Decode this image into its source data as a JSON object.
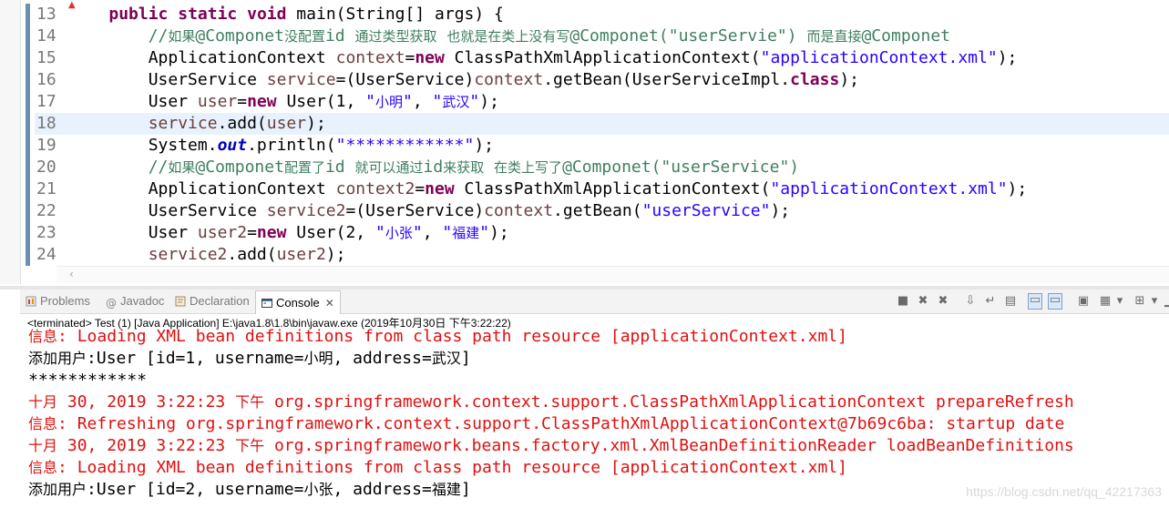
{
  "editor": {
    "lines": [
      {
        "num": "13",
        "segs": [
          [
            "pl",
            "    "
          ],
          [
            "kw",
            "public"
          ],
          [
            "pl",
            " "
          ],
          [
            "kw",
            "static"
          ],
          [
            "pl",
            " "
          ],
          [
            "kw",
            "void"
          ],
          [
            "pl",
            " main(String[] args) {"
          ]
        ]
      },
      {
        "num": "14",
        "segs": [
          [
            "pl",
            "        "
          ],
          [
            "cm",
            "//如果@Componet没配置id 通过类型获取 也就是在类上没有写@Componet(\"userServie\") 而是直接@Componet"
          ]
        ]
      },
      {
        "num": "15",
        "segs": [
          [
            "pl",
            "        ApplicationContext "
          ],
          [
            "var",
            "context"
          ],
          [
            "pl",
            "="
          ],
          [
            "kw",
            "new"
          ],
          [
            "pl",
            " ClassPathXmlApplicationContext("
          ],
          [
            "str",
            "\"applicationContext.xml\""
          ],
          [
            "pl",
            ");"
          ]
        ]
      },
      {
        "num": "16",
        "segs": [
          [
            "pl",
            "        UserService "
          ],
          [
            "var",
            "service"
          ],
          [
            "pl",
            "=(UserService)"
          ],
          [
            "var",
            "context"
          ],
          [
            "pl",
            ".getBean(UserServiceImpl."
          ],
          [
            "kw",
            "class"
          ],
          [
            "pl",
            ");"
          ]
        ]
      },
      {
        "num": "17",
        "segs": [
          [
            "pl",
            "        User "
          ],
          [
            "var",
            "user"
          ],
          [
            "pl",
            "="
          ],
          [
            "kw",
            "new"
          ],
          [
            "pl",
            " User(1, "
          ],
          [
            "str",
            "\"小明\""
          ],
          [
            "pl",
            ", "
          ],
          [
            "str",
            "\"武汉\""
          ],
          [
            "pl",
            ");"
          ]
        ]
      },
      {
        "num": "18",
        "segs": [
          [
            "pl",
            "        "
          ],
          [
            "var",
            "service"
          ],
          [
            "pl",
            ".add("
          ],
          [
            "var",
            "user"
          ],
          [
            "pl",
            ");"
          ]
        ]
      },
      {
        "num": "19",
        "segs": [
          [
            "pl",
            "        System."
          ],
          [
            "sf",
            "out"
          ],
          [
            "pl",
            ".println("
          ],
          [
            "str",
            "\"************\""
          ],
          [
            "pl",
            ");"
          ]
        ]
      },
      {
        "num": "20",
        "segs": [
          [
            "pl",
            "        "
          ],
          [
            "cm",
            "//如果@Componet配置了id 就可以通过id来获取 在类上写了@Componet(\"userService\")"
          ]
        ]
      },
      {
        "num": "21",
        "segs": [
          [
            "pl",
            "        ApplicationContext "
          ],
          [
            "var",
            "context2"
          ],
          [
            "pl",
            "="
          ],
          [
            "kw",
            "new"
          ],
          [
            "pl",
            " ClassPathXmlApplicationContext("
          ],
          [
            "str",
            "\"applicationContext.xml\""
          ],
          [
            "pl",
            ");"
          ]
        ]
      },
      {
        "num": "22",
        "segs": [
          [
            "pl",
            "        UserService "
          ],
          [
            "var",
            "service2"
          ],
          [
            "pl",
            "=(UserService)"
          ],
          [
            "var",
            "context"
          ],
          [
            "pl",
            ".getBean("
          ],
          [
            "str",
            "\"userService\""
          ],
          [
            "pl",
            ");"
          ]
        ]
      },
      {
        "num": "23",
        "segs": [
          [
            "pl",
            "        User "
          ],
          [
            "var",
            "user2"
          ],
          [
            "pl",
            "="
          ],
          [
            "kw",
            "new"
          ],
          [
            "pl",
            " User(2, "
          ],
          [
            "str",
            "\"小张\""
          ],
          [
            "pl",
            ", "
          ],
          [
            "str",
            "\"福建\""
          ],
          [
            "pl",
            ");"
          ]
        ]
      },
      {
        "num": "24",
        "segs": [
          [
            "pl",
            "        "
          ],
          [
            "var",
            "service2"
          ],
          [
            "pl",
            ".add("
          ],
          [
            "var",
            "user2"
          ],
          [
            "pl",
            ");"
          ]
        ]
      }
    ],
    "current_line": "18",
    "scroll_left_glyph": "‹"
  },
  "tabs": {
    "problems": "Problems",
    "javadoc": "Javadoc",
    "declaration": "Declaration",
    "console": "Console",
    "close_glyph": "✕"
  },
  "console": {
    "header": "<terminated> Test (1) [Java Application] E:\\java1.8\\1.8\\bin\\javaw.exe (2019年10月30日 下午3:22:22)",
    "lines": [
      {
        "kind": "err",
        "text": "信息: Loading XML bean definitions from class path resource [applicationContext.xml]"
      },
      {
        "kind": "out",
        "text": "添加用户:User [id=1, username=小明, address=武汉]"
      },
      {
        "kind": "out",
        "text": "************"
      },
      {
        "kind": "err",
        "text": "十月 30, 2019 3:22:23 下午 org.springframework.context.support.ClassPathXmlApplicationContext prepareRefresh"
      },
      {
        "kind": "err",
        "text": "信息: Refreshing org.springframework.context.support.ClassPathXmlApplicationContext@7b69c6ba: startup date"
      },
      {
        "kind": "err",
        "text": "十月 30, 2019 3:22:23 下午 org.springframework.beans.factory.xml.XmlBeanDefinitionReader loadBeanDefinitions"
      },
      {
        "kind": "err",
        "text": "信息: Loading XML bean definitions from class path resource [applicationContext.xml]"
      },
      {
        "kind": "out",
        "text": "添加用户:User [id=2, username=小张, address=福建]"
      }
    ],
    "watermark": "https://blog.csdn.net/qq_42217363"
  },
  "colors": {
    "keyword": "#7f0055",
    "string": "#2a00ff",
    "local_variable": "#6a3e3e",
    "comment": "#3f7f5f",
    "static_field": "#0000c0",
    "stderr": "#e01010",
    "current_line_bg": "#e8f2fe"
  },
  "icons": [
    "problems-icon",
    "javadoc-icon",
    "declaration-icon",
    "console-icon",
    "terminate-icon",
    "remove-launch-icon",
    "remove-all-icon",
    "scroll-lock-icon",
    "word-wrap-icon",
    "show-stdout-icon",
    "show-stderr-icon",
    "pin-console-icon",
    "display-console-icon",
    "open-console-icon",
    "minimize-icon",
    "maximize-icon"
  ]
}
